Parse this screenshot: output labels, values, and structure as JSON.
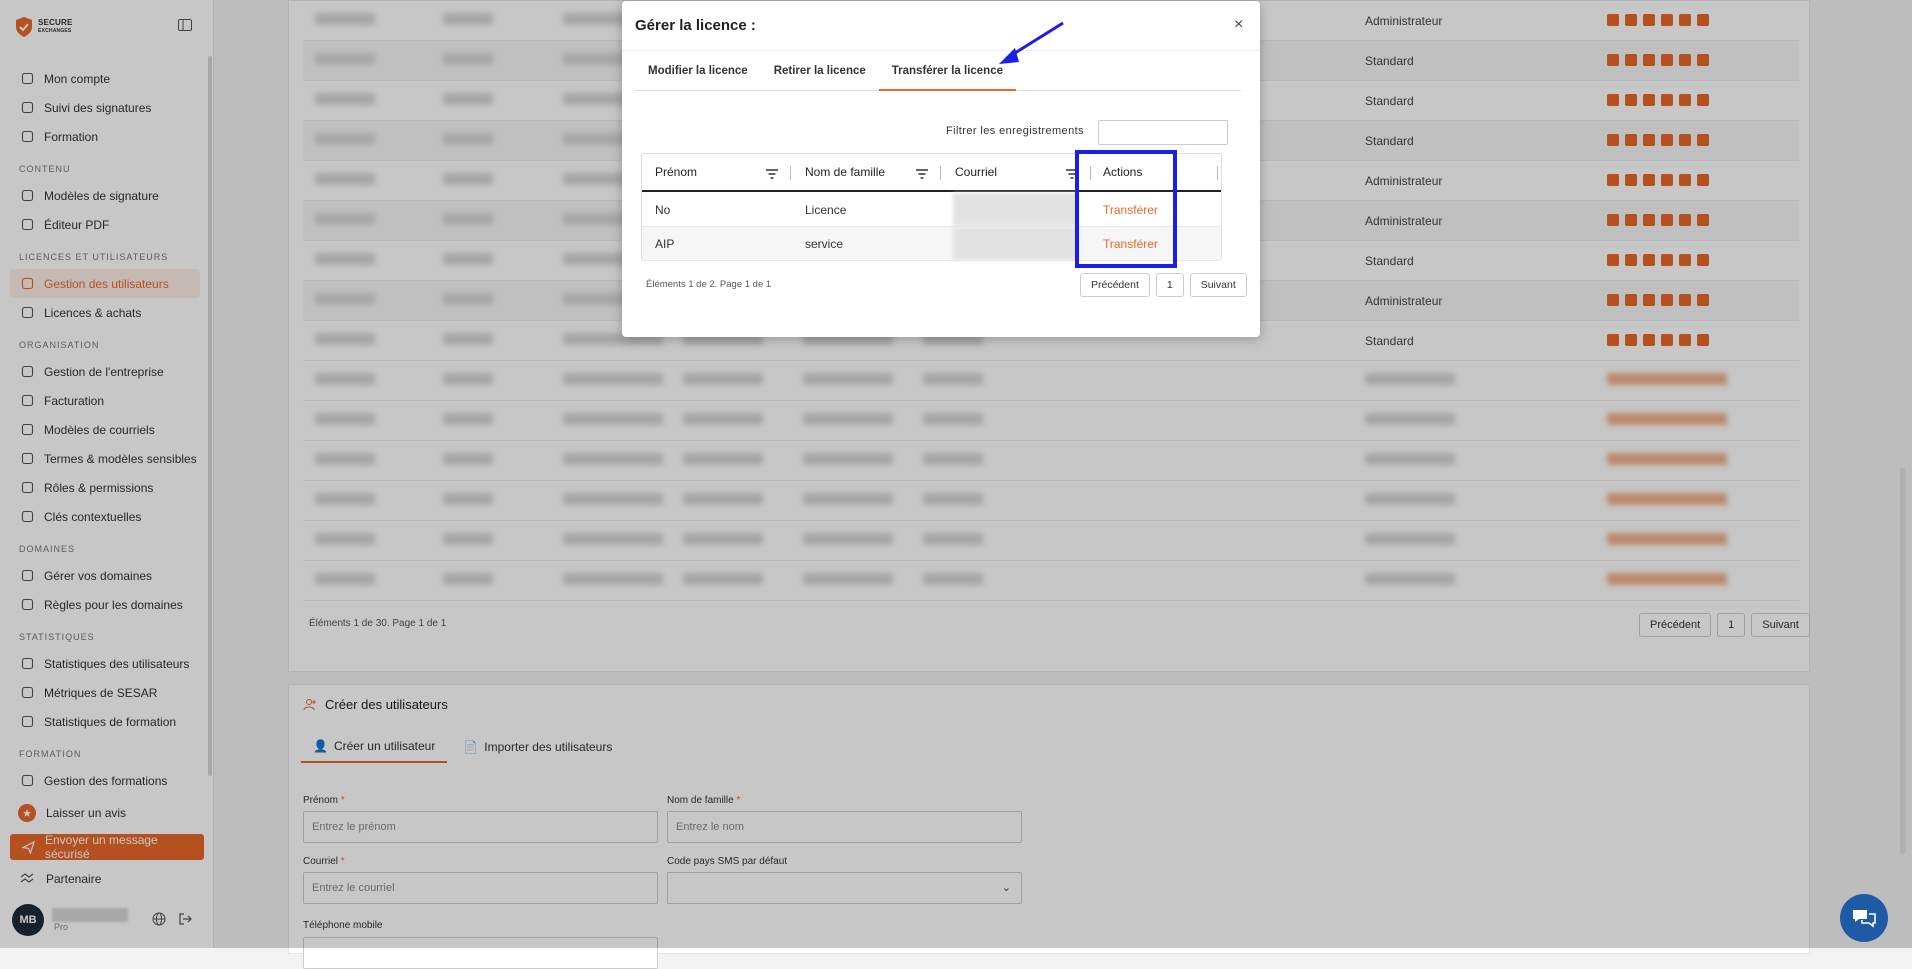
{
  "sidebar": {
    "logo_line1": "SECURE",
    "logo_line2": "EXCHANGES",
    "items_top": [
      {
        "label": "Mon compte",
        "icon": "user-icon"
      },
      {
        "label": "Suivi des signatures",
        "icon": "pen-icon"
      },
      {
        "label": "Formation",
        "icon": "graduation-cap-icon"
      }
    ],
    "sections": [
      {
        "title": "CONTENU",
        "items": [
          {
            "label": "Modèles de signature",
            "icon": "template-icon"
          },
          {
            "label": "Éditeur PDF",
            "icon": "pdf-icon"
          }
        ]
      },
      {
        "title": "LICENCES ET UTILISATEURS",
        "items": [
          {
            "label": "Gestion des utilisateurs",
            "icon": "users-icon",
            "active": true
          },
          {
            "label": "Licences & achats",
            "icon": "cube-icon"
          }
        ]
      },
      {
        "title": "ORGANISATION",
        "items": [
          {
            "label": "Gestion de l'entreprise",
            "icon": "building-icon"
          },
          {
            "label": "Facturation",
            "icon": "invoice-icon"
          },
          {
            "label": "Modèles de courriels",
            "icon": "mail-icon"
          },
          {
            "label": "Termes & modèles sensibles",
            "icon": "shield-icon"
          },
          {
            "label": "Rôles & permissions",
            "icon": "shield-check-icon"
          },
          {
            "label": "Clés contextuelles",
            "icon": "key-icon"
          }
        ]
      },
      {
        "title": "DOMAINES",
        "items": [
          {
            "label": "Gérer vos domaines",
            "icon": "globe-icon"
          },
          {
            "label": "Règles pour les domaines",
            "icon": "sliders-icon"
          }
        ]
      },
      {
        "title": "STATISTIQUES",
        "items": [
          {
            "label": "Statistiques des utilisateurs",
            "icon": "bar-chart-icon"
          },
          {
            "label": "Métriques de SESAR",
            "icon": "line-chart-icon"
          },
          {
            "label": "Statistiques de formation",
            "icon": "stats-icon"
          }
        ]
      },
      {
        "title": "FORMATION",
        "items": [
          {
            "label": "Gestion des formations",
            "icon": "book-icon"
          }
        ]
      }
    ],
    "review_label": "Laisser un avis",
    "send_label": "Envoyer un message sécurisé",
    "partner_label": "Partenaire",
    "user_initials": "MB",
    "user_role": "Pro"
  },
  "background": {
    "roles": [
      "Administrateur",
      "Standard",
      "Standard",
      "Standard",
      "Administrateur",
      "Administrateur",
      "Standard",
      "Administrateur",
      "Standard"
    ],
    "info": "Éléments 1 de 30. Page 1 de 1",
    "prev": "Précédent",
    "page": "1",
    "next": "Suivant",
    "create_title": "Créer des utilisateurs",
    "create_tab1": "Créer un utilisateur",
    "create_tab2": "Importer des utilisateurs",
    "label_prenom": "Prénom",
    "placeholder_prenom": "Entrez le prénom",
    "label_nom": "Nom de famille",
    "placeholder_nom": "Entrez le nom",
    "label_courriel": "Courriel",
    "placeholder_courriel": "Entrez le courriel",
    "label_sms": "Code pays SMS par défaut",
    "label_tel": "Téléphone mobile",
    "required_mark": "*"
  },
  "modal": {
    "title": "Gérer la licence :",
    "close": "×",
    "tabs": [
      {
        "label": "Modifier la licence",
        "active": false
      },
      {
        "label": "Retirer la licence",
        "active": false
      },
      {
        "label": "Transférer la licence",
        "active": true
      }
    ],
    "filter_label": "Filtrer les enregistrements",
    "columns": [
      "Prénom",
      "Nom de famille",
      "Courriel",
      "Actions"
    ],
    "rows": [
      {
        "prenom": "No",
        "nom": "Licence",
        "action": "Transférer"
      },
      {
        "prenom": "AIP",
        "nom": "service",
        "action": "Transférer"
      }
    ],
    "page_info": "Éléments 1 de 2. Page 1 de 1",
    "prev": "Précédent",
    "page": "1",
    "next": "Suivant"
  },
  "colors": {
    "accent": "#e8682a",
    "highlight": "#1a1ee6",
    "sidebar_active_bg": "#fdeee6"
  }
}
